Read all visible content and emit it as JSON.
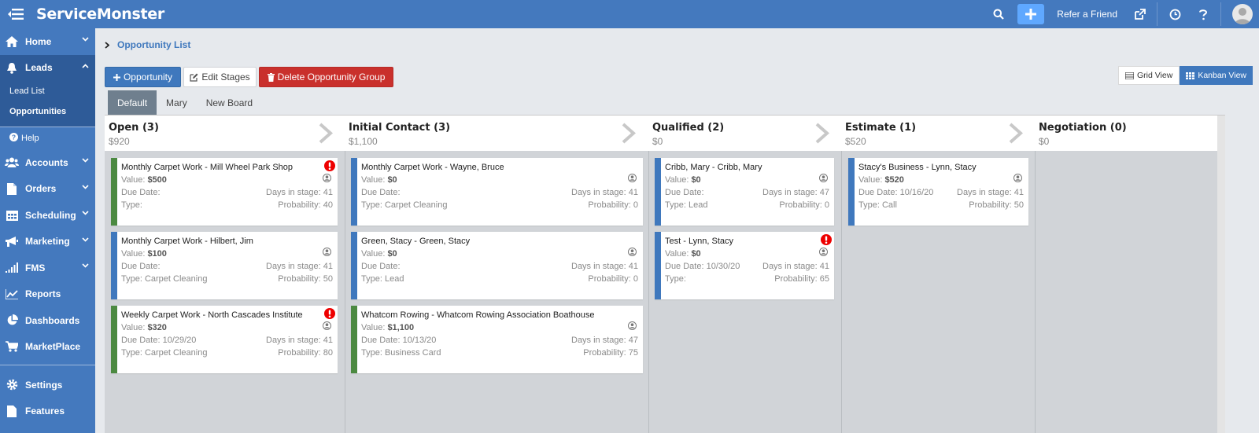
{
  "app": {
    "name": "ServiceMonster",
    "refer_label": "Refer a Friend"
  },
  "sidebar": {
    "items": [
      {
        "label": "Home",
        "icon": "home-icon"
      },
      {
        "label": "Leads",
        "icon": "bell-icon"
      },
      {
        "label": "Accounts",
        "icon": "users-icon"
      },
      {
        "label": "Orders",
        "icon": "file-icon"
      },
      {
        "label": "Scheduling",
        "icon": "calendar-icon"
      },
      {
        "label": "Marketing",
        "icon": "bullhorn-icon"
      },
      {
        "label": "FMS",
        "icon": "signal-icon"
      },
      {
        "label": "Reports",
        "icon": "line-chart-icon"
      },
      {
        "label": "Dashboards",
        "icon": "pie-chart-icon"
      },
      {
        "label": "MarketPlace",
        "icon": "cart-icon"
      },
      {
        "label": "Settings",
        "icon": "gear-icon"
      },
      {
        "label": "Features",
        "icon": "file-icon"
      }
    ],
    "leads_sub": [
      "Lead List",
      "Opportunities"
    ],
    "help_label": "Help"
  },
  "breadcrumb": {
    "label": "Opportunity List"
  },
  "actions": {
    "add_opportunity": "Opportunity",
    "edit_stages": "Edit Stages",
    "delete_group": "Delete Opportunity Group"
  },
  "views": {
    "grid": "Grid View",
    "kanban": "Kanban View"
  },
  "tabs": [
    "Default",
    "Mary",
    "New Board"
  ],
  "labels": {
    "value": "Value:",
    "due_date": "Due Date:",
    "type": "Type:",
    "days_in_stage": "Days in stage:",
    "probability": "Probability:"
  },
  "columns": [
    {
      "title": "Open (3)",
      "total": "$920",
      "cards": [
        {
          "title": "Monthly Carpet Work - Mill Wheel Park Shop",
          "value": "$500",
          "due": "",
          "type": "",
          "days": "41",
          "prob": "40",
          "color": "#4c8a41",
          "alert": true
        },
        {
          "title": "Monthly Carpet Work - Hilbert, Jim",
          "value": "$100",
          "due": "",
          "type": "Carpet Cleaning",
          "days": "41",
          "prob": "50",
          "color": "#3f78bd",
          "alert": false
        },
        {
          "title": "Weekly Carpet Work - North Cascades Institute",
          "value": "$320",
          "due": "10/29/20",
          "type": "Carpet Cleaning",
          "days": "41",
          "prob": "80",
          "color": "#4c8a41",
          "alert": true
        }
      ]
    },
    {
      "title": "Initial Contact (3)",
      "total": "$1,100",
      "cards": [
        {
          "title": "Monthly Carpet Work - Wayne, Bruce",
          "value": "$0",
          "due": "",
          "type": "Carpet Cleaning",
          "days": "41",
          "prob": "0",
          "color": "#3f78bd",
          "alert": false
        },
        {
          "title": "Green, Stacy - Green, Stacy",
          "value": "$0",
          "due": "",
          "type": "Lead",
          "days": "41",
          "prob": "0",
          "color": "#3f78bd",
          "alert": false
        },
        {
          "title": "Whatcom Rowing - Whatcom Rowing Association Boathouse",
          "value": "$1,100",
          "due": "10/13/20",
          "type": "Business Card",
          "days": "47",
          "prob": "75",
          "color": "#4c8a41",
          "alert": false
        }
      ]
    },
    {
      "title": "Qualified (2)",
      "total": "$0",
      "cards": [
        {
          "title": "Cribb, Mary - Cribb, Mary",
          "value": "$0",
          "due": "",
          "type": "Lead",
          "days": "47",
          "prob": "0",
          "color": "#3f78bd",
          "alert": false
        },
        {
          "title": "Test - Lynn, Stacy",
          "value": "$0",
          "due": "10/30/20",
          "type": "",
          "days": "41",
          "prob": "65",
          "color": "#3f78bd",
          "alert": true
        }
      ]
    },
    {
      "title": "Estimate (1)",
      "total": "$520",
      "cards": [
        {
          "title": "Stacy's Business - Lynn, Stacy",
          "value": "$520",
          "due": "10/16/20",
          "type": "Call",
          "days": "41",
          "prob": "50",
          "color": "#3f78bd",
          "alert": false
        }
      ]
    },
    {
      "title": "Negotiation (0)",
      "total": "$0",
      "cards": []
    }
  ]
}
